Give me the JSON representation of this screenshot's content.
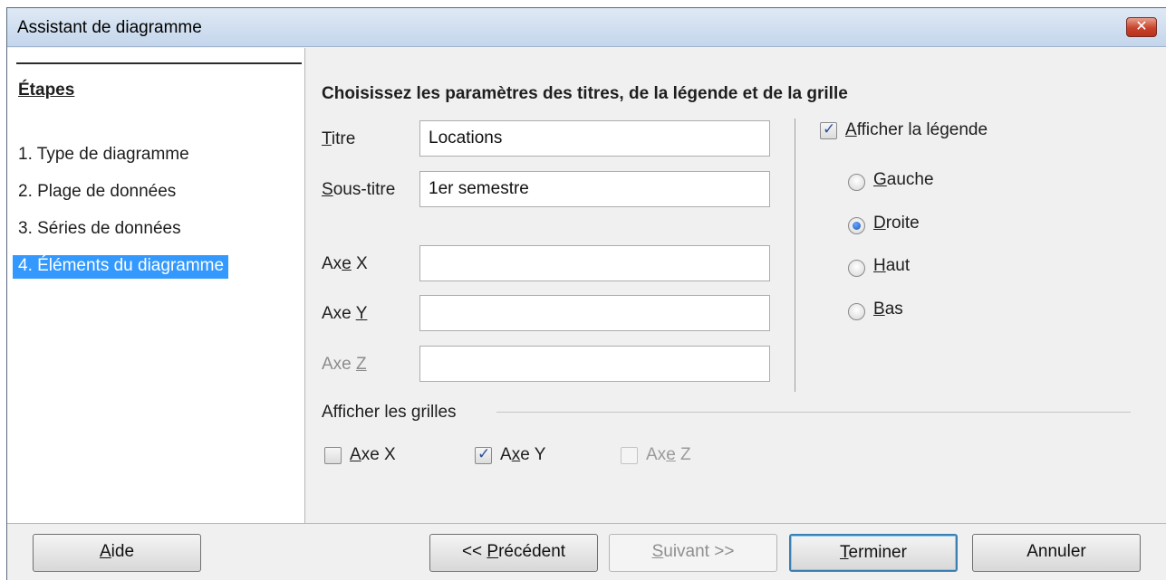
{
  "window": {
    "title": "Assistant de diagramme",
    "close_glyph": "✕"
  },
  "sidebar": {
    "heading": "Étapes",
    "steps": [
      {
        "label": "1. Type de diagramme"
      },
      {
        "label": "2. Plage de données"
      },
      {
        "label": "3. Séries de données"
      },
      {
        "label": "4. Éléments du diagramme",
        "active": true
      }
    ]
  },
  "main": {
    "section_title": "Choisissez les paramètres des titres, de la légende et de la grille",
    "fields": {
      "titre": {
        "label_u": "T",
        "label_rest": "itre",
        "value": "Locations"
      },
      "sous_titre": {
        "label_u": "S",
        "label_rest": "ous-titre",
        "value": "1er semestre"
      },
      "axe_x": {
        "label_pre": "Ax",
        "label_u": "e",
        "label_rest": " X",
        "value": ""
      },
      "axe_y": {
        "label_pre": "Axe ",
        "label_u": "Y",
        "label_rest": "",
        "value": ""
      },
      "axe_z": {
        "label_pre": "Axe ",
        "label_u": "Z",
        "label_rest": "",
        "value": "",
        "disabled": true
      }
    },
    "legend": {
      "show_label_u": "A",
      "show_label_rest": "fficher la légende",
      "show_checked": true,
      "positions": [
        {
          "u": "G",
          "rest": "auche",
          "selected": false
        },
        {
          "u": "D",
          "rest": "roite",
          "selected": true
        },
        {
          "u": "H",
          "rest": "aut",
          "selected": false
        },
        {
          "u": "B",
          "rest": "as",
          "selected": false
        }
      ]
    },
    "grids": {
      "title": "Afficher les grilles",
      "x": {
        "u": "A",
        "rest": "xe X",
        "checked": false
      },
      "y": {
        "pre": "A",
        "u": "x",
        "rest": "e Y",
        "checked": true
      },
      "z": {
        "pre": "Ax",
        "u": "e",
        "rest": " Z",
        "checked": false,
        "disabled": true
      }
    }
  },
  "footer": {
    "help": {
      "u": "A",
      "rest": "ide"
    },
    "prev": {
      "pre": "<< ",
      "u": "P",
      "rest": "récédent"
    },
    "next": {
      "u": "S",
      "rest": "uivant >>",
      "disabled": true
    },
    "finish": {
      "u": "T",
      "rest": "erminer"
    },
    "cancel": {
      "label": "Annuler"
    }
  },
  "colors": {
    "selection": "#3399ff",
    "titlebar": "#c4d6ec",
    "close": "#c7432c"
  }
}
